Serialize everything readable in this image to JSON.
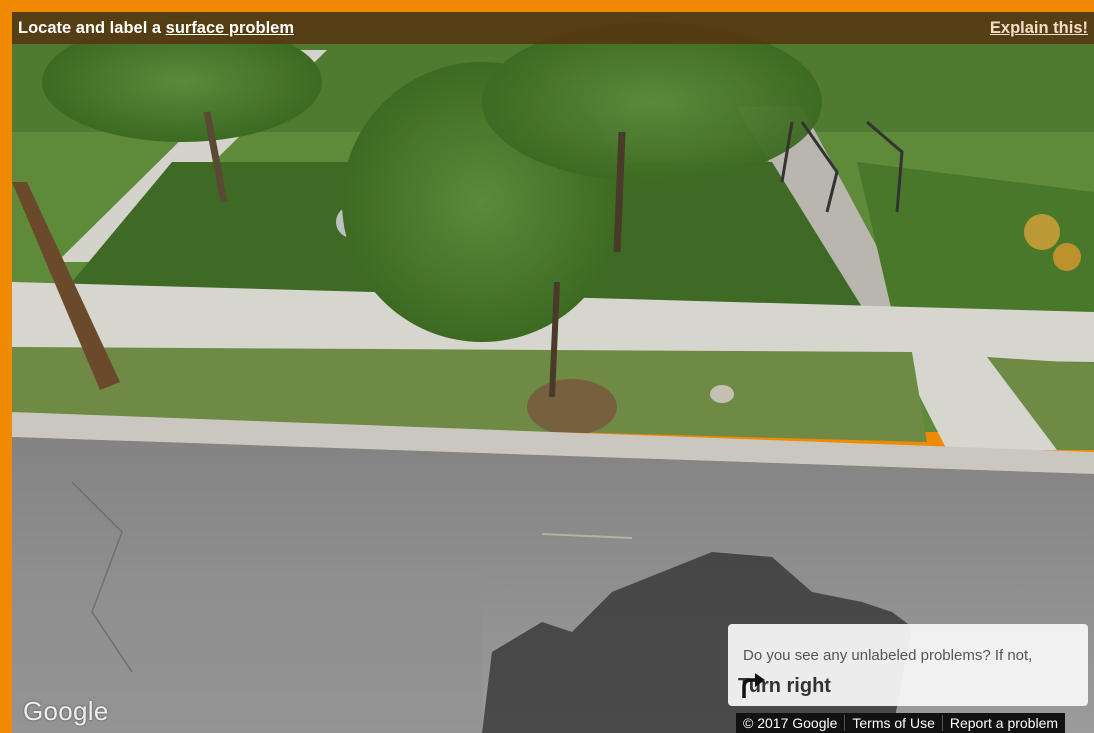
{
  "header": {
    "task_prefix": "Locate and label a ",
    "task_link": "surface problem",
    "explain_link": "Explain this!"
  },
  "prompt": {
    "question": "Do you see any unlabeled problems? If not,",
    "turn_label": "Turn right"
  },
  "footer": {
    "google_logo": "Google",
    "copyright": "© 2017 Google",
    "terms": "Terms of Use",
    "report": "Report a problem"
  },
  "colors": {
    "frame": "#f08a00",
    "header_bg": "#563410",
    "prompt_bg": "#f5f5f5"
  }
}
